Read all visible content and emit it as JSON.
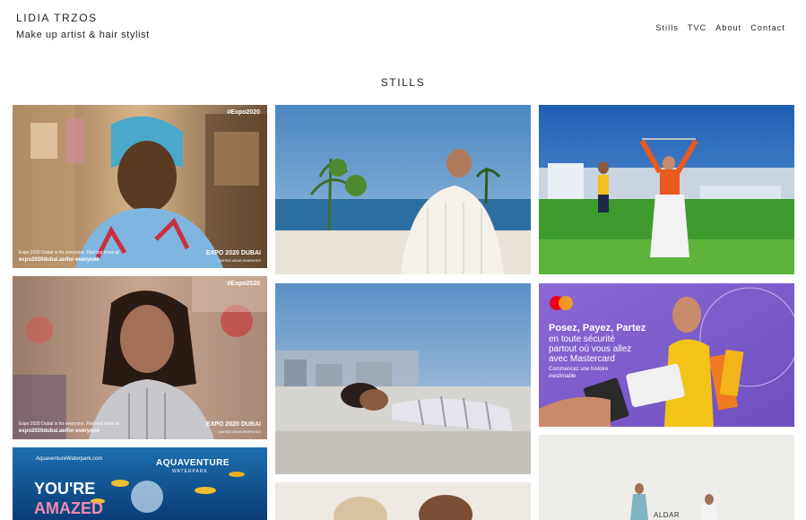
{
  "header": {
    "brand_name": "LIDIA TRZOS",
    "brand_tagline": "Make up artist & hair stylist",
    "nav": [
      "Stills",
      "TVC",
      "About",
      "Contact"
    ]
  },
  "section": {
    "title": "STILLS"
  },
  "tiles": {
    "expo_woman": {
      "hashtag": "#Expo2020",
      "caption_line1": "Expo 2020 Dubai is for everyone. Find out more at",
      "caption_line2": "expo2020dubai.ae/for-everyone",
      "logo_line1": "EXPO 2020 DUBAI",
      "logo_line2": "UNITED ARAB EMIRATES"
    },
    "expo_man": {
      "hashtag": "#Expo2020",
      "caption_line1": "Expo 2020 Dubai is for everyone. Find out more at",
      "caption_line2": "expo2020dubai.ae/for-everyone",
      "logo_line1": "EXPO 2020 DUBAI",
      "logo_line2": "UNITED ARAB EMIRATES"
    },
    "aquaventure": {
      "url": "AquaventureWaterpark.com",
      "brand": "AQUAVENTURE",
      "brand_sub": "WATERPARK",
      "headline_1": "YOU'RE",
      "headline_2": "AMAZED"
    },
    "mastercard": {
      "line1": "Posez, Payez, Partez",
      "line2": "en toute sécurité",
      "line3": "partout où vous allez",
      "line4": "avec Mastercard",
      "sub1": "Commencez une histoire",
      "sub2": "inestimable",
      "brand": "mastercard"
    },
    "aldar": {
      "brand": "ALDAR"
    }
  }
}
